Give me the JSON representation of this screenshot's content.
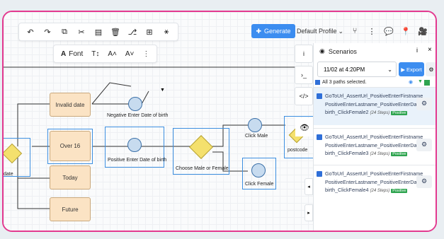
{
  "toolbar_left": {
    "icons": [
      "undo-icon",
      "redo-icon",
      "copy-icon",
      "cut-icon",
      "paste-icon",
      "delete-icon",
      "hierarchy-icon",
      "table-icon",
      "network-icon"
    ],
    "glyphs": [
      "↶",
      "↷",
      "⧉",
      "✂",
      "▤",
      "🗑",
      "⎇",
      "⊞",
      "⚹"
    ]
  },
  "font_bar": {
    "font_label": "Font",
    "text_size": "T↕",
    "increase": "A˄",
    "decrease": "A˅",
    "more": "⋮"
  },
  "generate_label": "Generate",
  "profile_label": "Default Profile",
  "flow": {
    "invalid_date": "Invalid date",
    "over_16": "Over 16",
    "today": "Today",
    "future": "Future",
    "date": "date",
    "negative_dob": "Negative Enter Date of birth",
    "positive_dob": "Positive Enter Date of birth",
    "choose_gender": "Choose Male or Female",
    "click_male": "Click  Male",
    "click_female": "Click  Female",
    "postcode": "postcode"
  },
  "panel": {
    "title": "Scenarios",
    "info": "i",
    "close": "×",
    "date_value": "11/02 at 4:20PM",
    "export_label": "Export",
    "all_selected": "All 3 paths selected.",
    "paths": [
      {
        "name": "GoToUrl_AssertUrl_PositiveEnterFirstname_ PositiveEnterLastname_PositiveEnterDateof birth_ClickFemale2",
        "steps": "(24 Steps)",
        "badge": "Positive"
      },
      {
        "name": "GoToUrl_AssertUrl_PositiveEnterFirstname_ PositiveEnterLastname_PositiveEnterDateof birth_ClickFemale3",
        "steps": "(24 Steps)",
        "badge": "Positive"
      },
      {
        "name": "GoToUrl_AssertUrl_PositiveEnterFirstname_ PositiveEnterLastname_PositiveEnterDateof birth_ClickFemale4",
        "steps": "(24 Steps)",
        "badge": "Positive"
      }
    ]
  },
  "side_tabs": [
    "i",
    "›_",
    "</>"
  ],
  "colors": {
    "accent": "#3c8df0",
    "frame": "#e3398f",
    "positive": "#2ea44f"
  }
}
